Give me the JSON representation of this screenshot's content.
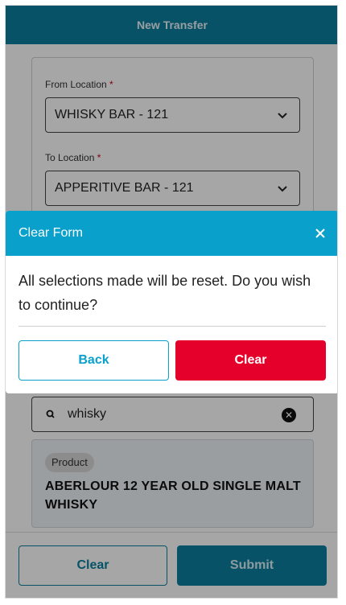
{
  "header": {
    "title": "New Transfer"
  },
  "form": {
    "from_label": "From Location",
    "from_value": "WHISKY BAR - 121",
    "to_label": "To Location",
    "to_value": "APPERITIVE BAR - 121",
    "required_mark": "*"
  },
  "search": {
    "value": "whisky",
    "clear_glyph": "✕"
  },
  "product": {
    "tag": "Product",
    "name": "ABERLOUR 12 YEAR OLD SINGLE MALT WHISKY"
  },
  "footer": {
    "clear_label": "Clear",
    "submit_label": "Submit"
  },
  "modal": {
    "title": "Clear Form",
    "message": "All selections made will be reset. Do you wish to continue?",
    "back_label": "Back",
    "clear_label": "Clear"
  },
  "colors": {
    "primary": "#0c7f9f",
    "modal_header": "#0aa0cc",
    "danger": "#e4002b"
  }
}
